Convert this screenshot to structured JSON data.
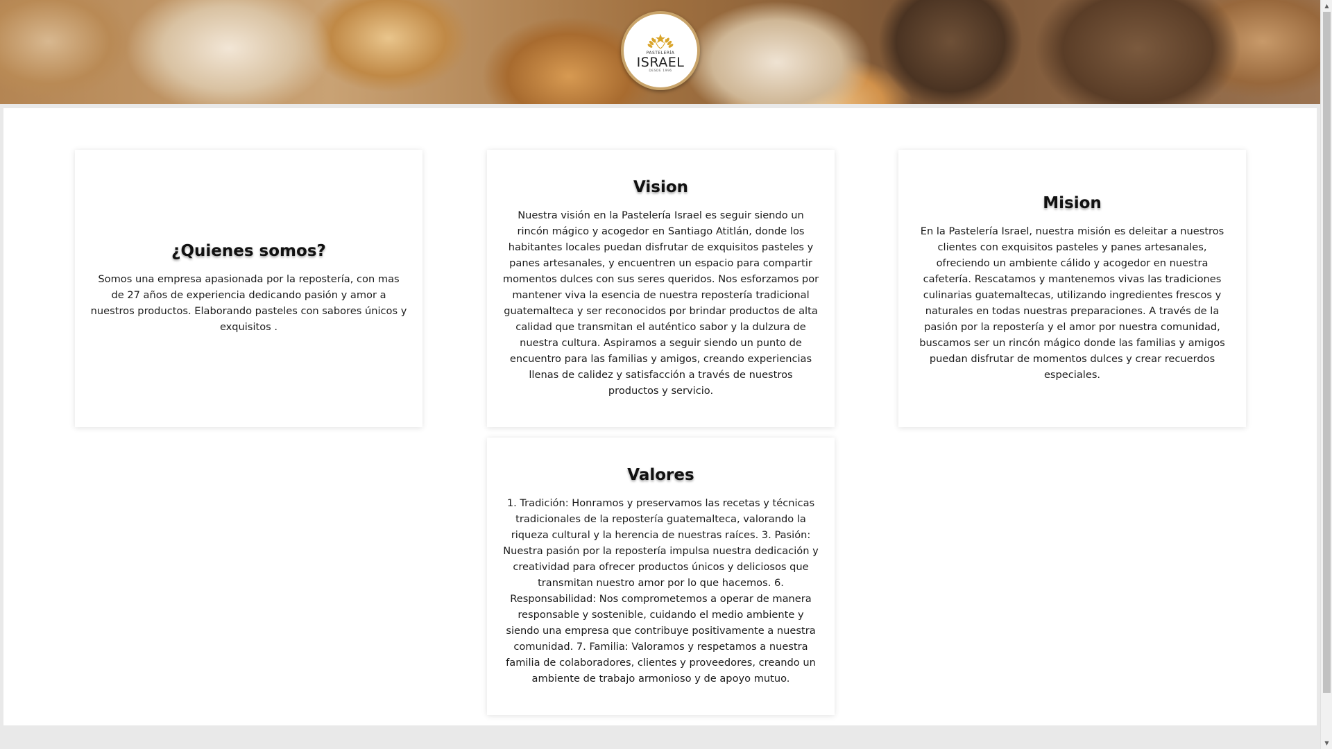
{
  "header": {
    "logo": {
      "top_text": "PASTELERÍA",
      "brand": "ISRAEL",
      "since": "DESDE 1996"
    }
  },
  "cards": {
    "quienes": {
      "title": "¿Quienes somos?",
      "body": "Somos una empresa apasionada por la repostería, con mas de 27 años de experiencia dedicando pasión y amor a nuestros productos. Elaborando pasteles con sabores únicos y exquisitos ."
    },
    "vision": {
      "title": "Vision",
      "body": "Nuestra visión en la Pastelería Israel es seguir siendo un rincón mágico y acogedor en Santiago Atitlán, donde los habitantes locales puedan disfrutar de exquisitos pasteles y panes artesanales, y encuentren un espacio para compartir momentos dulces con sus seres queridos. Nos esforzamos por mantener viva la esencia de nuestra repostería tradicional guatemalteca y ser reconocidos por brindar productos de alta calidad que transmitan el auténtico sabor y la dulzura de nuestra cultura. Aspiramos a seguir siendo un punto de encuentro para las familias y amigos, creando experiencias llenas de calidez y satisfacción a través de nuestros productos y servicio."
    },
    "mision": {
      "title": "Mision",
      "body": "En la Pastelería Israel, nuestra misión es deleitar a nuestros clientes con exquisitos pasteles y panes artesanales, ofreciendo un ambiente cálido y acogedor en nuestra cafetería. Rescatamos y mantenemos vivas las tradiciones culinarias guatemaltecas, utilizando ingredientes frescos y naturales en todas nuestras preparaciones. A través de la pasión por la repostería y el amor por nuestra comunidad, buscamos ser un rincón mágico donde las familias y amigos puedan disfrutar de momentos dulces y crear recuerdos especiales."
    },
    "valores": {
      "title": "Valores",
      "body": "1. Tradición: Honramos y preservamos las recetas y técnicas tradicionales de la repostería guatemalteca, valorando la riqueza cultural y la herencia de nuestras raíces. 3. Pasión: Nuestra pasión por la repostería impulsa nuestra dedicación y creatividad para ofrecer productos únicos y deliciosos que transmitan nuestro amor por lo que hacemos. 6. Responsabilidad: Nos comprometemos a operar de manera responsable y sostenible, cuidando el medio ambiente y siendo una empresa que contribuye positivamente a nuestra comunidad. 7. Familia: Valoramos y respetamos a nuestra familia de colaboradores, clientes y proveedores, creando un ambiente de trabajo armonioso y de apoyo mutuo."
    }
  },
  "colors": {
    "logo_ring": "#c9a46a",
    "wheat": "#d9a42a"
  },
  "icons": {
    "logo_mark": "wheat-star-icon",
    "scroll_up": "arrow-up-icon",
    "scroll_down": "arrow-down-icon"
  }
}
